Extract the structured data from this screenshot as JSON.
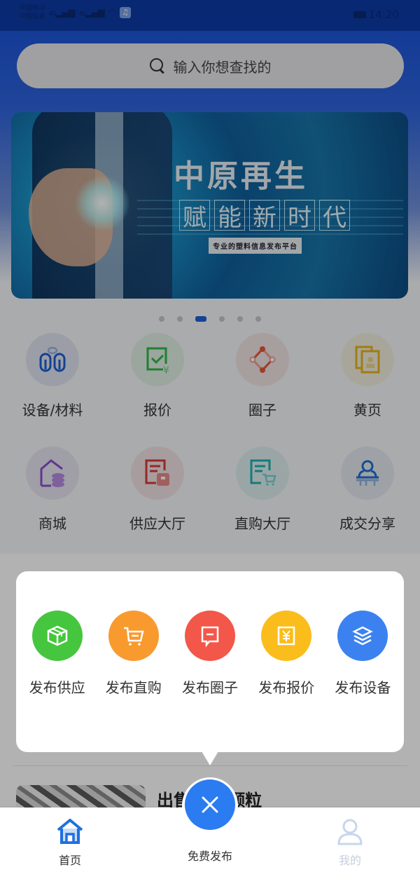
{
  "status_bar": {
    "carrier_line1": "中国移动",
    "carrier_line2": "中国联通",
    "signal_1": "4G",
    "signal_2": "4G",
    "music_icon": "♫",
    "time": "14:20"
  },
  "search": {
    "placeholder": "输入你想查找的",
    "icon": "search-icon"
  },
  "banner": {
    "title": "中原再生",
    "subtitle_chars": [
      "赋",
      "能",
      "新",
      "时",
      "代"
    ],
    "tag": "专业的塑料信息发布平台",
    "page_count": 6,
    "active_index": 2
  },
  "grid": {
    "items": [
      {
        "label": "设备/材料",
        "icon": "equipment-icon",
        "color": "#1f5fd0",
        "bg": "#dfe3ee"
      },
      {
        "label": "报价",
        "icon": "quote-icon",
        "color": "#2eb84a",
        "bg": "#dfeee2"
      },
      {
        "label": "圈子",
        "icon": "circle-icon",
        "color": "#e2563a",
        "bg": "#f0e3e2"
      },
      {
        "label": "黄页",
        "icon": "yellow-pages-icon",
        "color": "#e8b21c",
        "bg": "#f1eedf"
      },
      {
        "label": "商城",
        "icon": "mall-icon",
        "color": "#8a4fd0",
        "bg": "#e6e2ee"
      },
      {
        "label": "供应大厅",
        "icon": "supply-hall-icon",
        "color": "#d63a3a",
        "bg": "#f0e1e2"
      },
      {
        "label": "直购大厅",
        "icon": "purchase-hall-icon",
        "color": "#1fb0b0",
        "bg": "#ddeeee"
      },
      {
        "label": "成交分享",
        "icon": "deal-share-icon",
        "color": "#1f6fd0",
        "bg": "#e3e7ee"
      }
    ]
  },
  "product": {
    "title": "出售ABS颗粒"
  },
  "publish_popup": {
    "items": [
      {
        "label": "发布供应",
        "icon": "box-icon",
        "color": "#45c63e"
      },
      {
        "label": "发布直购",
        "icon": "cart-icon",
        "color": "#f99a2e"
      },
      {
        "label": "发布圈子",
        "icon": "message-icon",
        "color": "#f2574a"
      },
      {
        "label": "发布报价",
        "icon": "yen-icon",
        "color": "#fbbd1c"
      },
      {
        "label": "发布设备",
        "icon": "layers-icon",
        "color": "#3b82f0"
      }
    ]
  },
  "tabbar": {
    "home_label": "首页",
    "publish_label": "免费发布",
    "mine_label": "我的",
    "accent": "#1f6fe0"
  }
}
